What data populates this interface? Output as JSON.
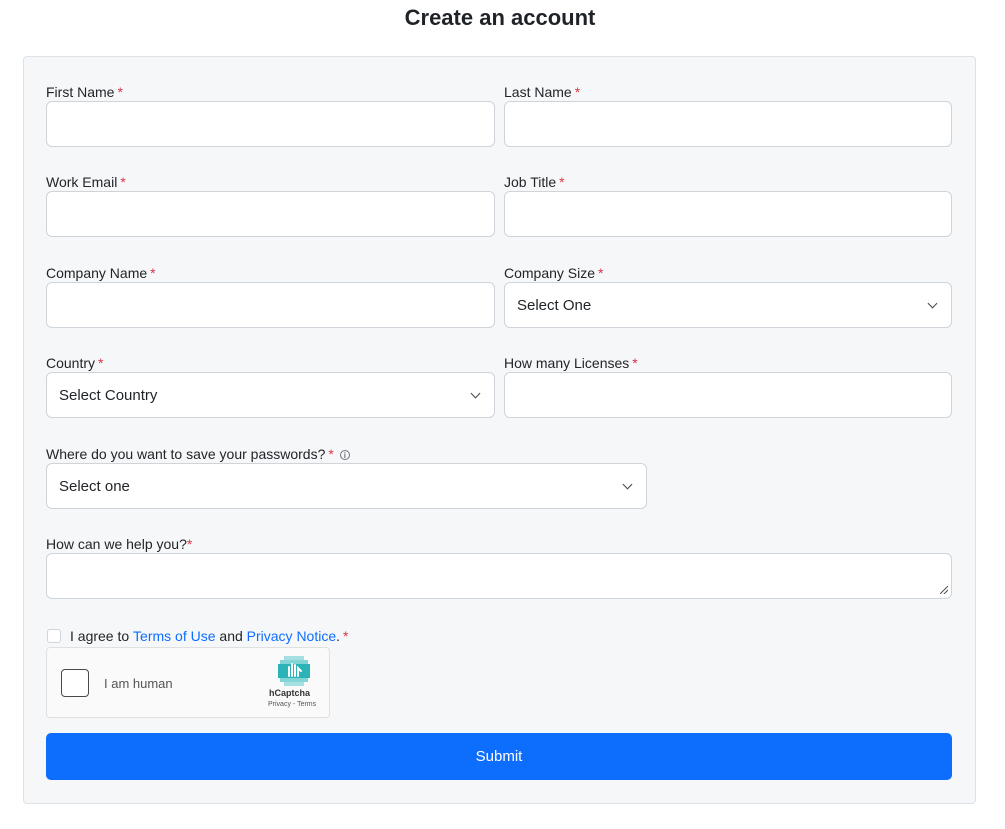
{
  "page": {
    "title": "Create an account"
  },
  "form": {
    "first_name": {
      "label": "First Name",
      "required": "*",
      "value": ""
    },
    "last_name": {
      "label": "Last Name",
      "required": "*",
      "value": ""
    },
    "work_email": {
      "label": "Work Email",
      "required": "*",
      "value": ""
    },
    "job_title": {
      "label": "Job Title",
      "required": "*",
      "value": ""
    },
    "company_name": {
      "label": "Company Name",
      "required": "*",
      "value": ""
    },
    "company_size": {
      "label": "Company Size",
      "required": "*",
      "selected": "Select One"
    },
    "country": {
      "label": "Country",
      "required": "*",
      "selected": "Select Country"
    },
    "licenses": {
      "label": "How many Licenses",
      "required": "*",
      "value": ""
    },
    "password_storage": {
      "label": "Where do you want to save your passwords?",
      "required": "*",
      "info_icon": "info-icon",
      "selected": "Select one"
    },
    "help": {
      "label": "How can we help you?",
      "required": "*",
      "value": ""
    },
    "agree": {
      "prefix": "I agree to",
      "terms_link": "Terms of Use",
      "middle": "and",
      "privacy_link": "Privacy Notice",
      "suffix": ".",
      "required": "*",
      "checked": false
    },
    "captcha": {
      "label": "I am human",
      "brand": "hCaptcha",
      "privacy": "Privacy",
      "separator": "-",
      "terms": "Terms"
    },
    "submit_label": "Submit"
  },
  "colors": {
    "accent": "#0d6efd",
    "required": "#dc3545",
    "card_bg": "#f6f7f9",
    "captcha_logo": "#4fc3c7"
  }
}
